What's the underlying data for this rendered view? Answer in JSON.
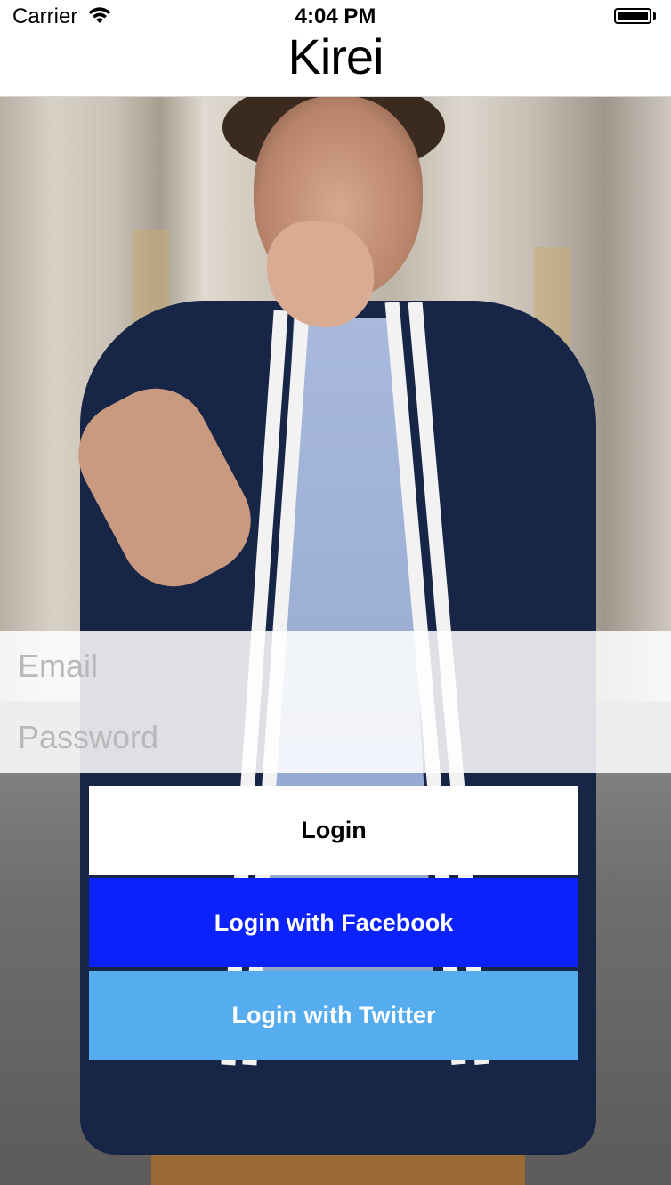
{
  "status_bar": {
    "carrier": "Carrier",
    "time": "4:04 PM",
    "wifi_icon": "wifi-icon",
    "battery_icon": "battery-icon"
  },
  "nav": {
    "title": "Kirei"
  },
  "background": {
    "image": "photo of man in navy cardigan and blue shirt on a city street"
  },
  "login_form": {
    "email_placeholder": "Email",
    "email_value": "",
    "password_placeholder": "Password",
    "password_value": ""
  },
  "buttons": {
    "login_label": "Login",
    "facebook_label": "Login with Facebook",
    "twitter_label": "Login with Twitter"
  },
  "colors": {
    "facebook": "#0b22fb",
    "twitter": "#55acee",
    "login": "#ffffff"
  }
}
